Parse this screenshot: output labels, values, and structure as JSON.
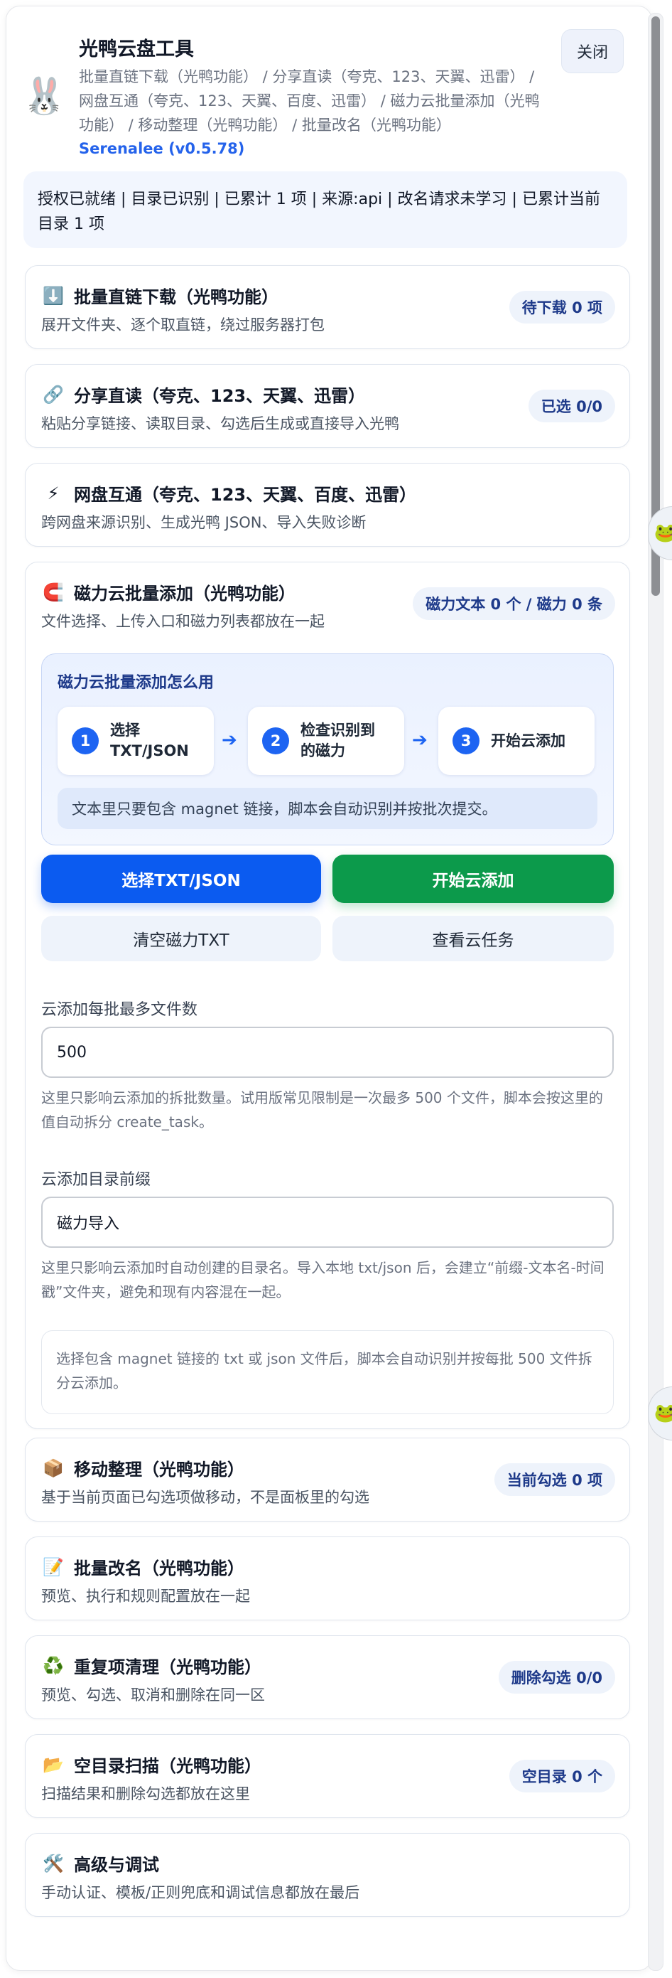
{
  "header": {
    "title": "光鸭云盘工具",
    "description": "批量直链下载（光鸭功能） / 分享直读（夸克、123、天翼、迅雷） / 网盘互通（夸克、123、天翼、百度、迅雷） / 磁力云批量添加（光鸭功能） / 移动整理（光鸭功能） / 批量改名（光鸭功能）",
    "version": "Serenalee (v0.5.78)",
    "close_label": "关闭",
    "logo_icon": "rabbit-icon"
  },
  "status": {
    "text": "授权已就绪 | 目录已识别 | 已累计 1 项 | 来源:api | 改名请求未学习 | 已累计当前目录 1 项"
  },
  "sections": {
    "direct_download": {
      "icon": "⬇️",
      "title": "批量直链下载（光鸭功能）",
      "subtitle": "展开文件夹、逐个取直链，绕过服务器打包",
      "badge": "待下载 0 项"
    },
    "share_read": {
      "icon": "🔗",
      "title": "分享直读（夸克、123、天翼、迅雷）",
      "subtitle": "粘贴分享链接、读取目录、勾选后生成或直接导入光鸭",
      "badge": "已选 0/0"
    },
    "cross_disk": {
      "icon": "⚡",
      "title": "网盘互通（夸克、123、天翼、百度、迅雷）",
      "subtitle": "跨网盘来源识别、生成光鸭 JSON、导入失败诊断"
    },
    "magnet": {
      "icon": "🧲",
      "title": "磁力云批量添加（光鸭功能）",
      "subtitle": "文件选择、上传入口和磁力列表都放在一起",
      "badge": "磁力文本 0 个 / 磁力 0 条",
      "howto_title": "磁力云批量添加怎么用",
      "steps": [
        {
          "num": "1",
          "label_line1": "选择",
          "label_line2": "TXT/JSON"
        },
        {
          "num": "2",
          "label_line1": "检查识别到",
          "label_line2": "的磁力"
        },
        {
          "num": "3",
          "label_line1": "开始云添加",
          "label_line2": ""
        }
      ],
      "howto_note": "文本里只要包含 magnet 链接，脚本会自动识别并按批次提交。",
      "btn_select": "选择TXT/JSON",
      "btn_start": "开始云添加",
      "btn_clear": "清空磁力TXT",
      "btn_view": "查看云任务",
      "batch_label": "云添加每批最多文件数",
      "batch_value": "500",
      "batch_help": "这里只影响云添加的拆批数量。试用版常见限制是一次最多 500 个文件，脚本会按这里的值自动拆分 create_task。",
      "prefix_label": "云添加目录前缀",
      "prefix_value": "磁力导入",
      "prefix_help": "这里只影响云添加时自动创建的目录名。导入本地 txt/json 后，会建立“前缀-文本名-时间戳”文件夹，避免和现有内容混在一起。",
      "info": "选择包含 magnet 链接的 txt 或 json 文件后，脚本会自动识别并按每批 500 文件拆分云添加。"
    },
    "move": {
      "icon": "📦",
      "title": "移动整理（光鸭功能）",
      "subtitle": "基于当前页面已勾选项做移动，不是面板里的勾选",
      "badge": "当前勾选 0 项"
    },
    "rename": {
      "icon": "📝",
      "title": "批量改名（光鸭功能）",
      "subtitle": "预览、执行和规则配置放在一起"
    },
    "dedupe": {
      "icon": "♻️",
      "title": "重复项清理（光鸭功能）",
      "subtitle": "预览、勾选、取消和删除在同一区",
      "badge": "删除勾选 0/0"
    },
    "empty_dir": {
      "icon": "📂",
      "title": "空目录扫描（光鸭功能）",
      "subtitle": "扫描结果和删除勾选都放在这里",
      "badge": "空目录 0 个"
    },
    "advanced": {
      "icon": "🛠️",
      "title": "高级与调试",
      "subtitle": "手动认证、模板/正则兜底和调试信息都放在最后"
    }
  },
  "colors": {
    "accent": "#0b5bf0",
    "success": "#0c9a4b",
    "version": "#2563eb"
  }
}
